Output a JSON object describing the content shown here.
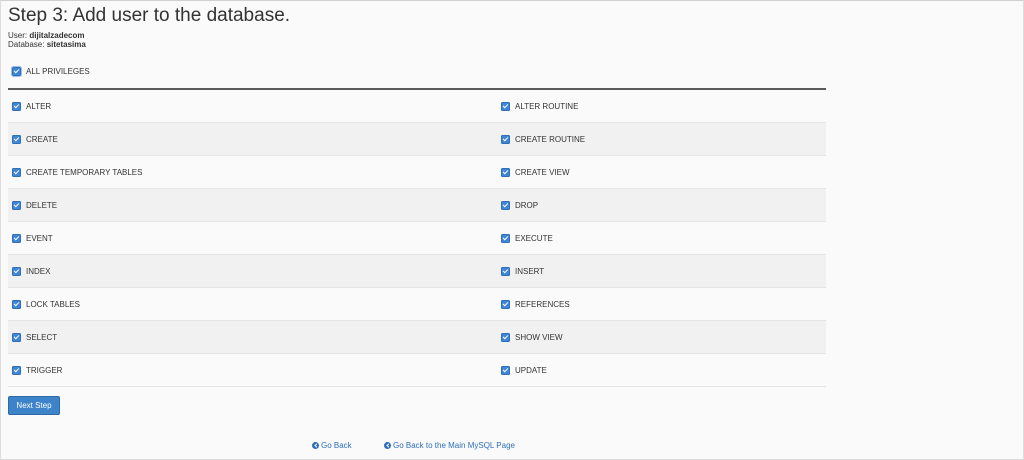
{
  "page": {
    "title": "Step 3: Add user to the database."
  },
  "meta": {
    "user_label": "User:",
    "user_value": "dijitalzadecom",
    "database_label": "Database:",
    "database_value": "sitetasima"
  },
  "all_privileges": {
    "label": "ALL PRIVILEGES",
    "checked": true
  },
  "privileges": {
    "rows": [
      {
        "left": "ALTER",
        "right": "ALTER ROUTINE"
      },
      {
        "left": "CREATE",
        "right": "CREATE ROUTINE"
      },
      {
        "left": "CREATE TEMPORARY TABLES",
        "right": "CREATE VIEW"
      },
      {
        "left": "DELETE",
        "right": "DROP"
      },
      {
        "left": "EVENT",
        "right": "EXECUTE"
      },
      {
        "left": "INDEX",
        "right": "INSERT"
      },
      {
        "left": "LOCK TABLES",
        "right": "REFERENCES"
      },
      {
        "left": "SELECT",
        "right": "SHOW VIEW"
      },
      {
        "left": "TRIGGER",
        "right": "UPDATE"
      }
    ]
  },
  "actions": {
    "next_step_label": "Next Step"
  },
  "footer_links": {
    "go_back": "Go Back",
    "go_back_main": "Go Back to the Main MySQL Page"
  },
  "colors": {
    "accent": "#3d83c9",
    "checkbox": "#3f86d8",
    "link": "#2f6fba",
    "row_alt": "#f1f1f1"
  }
}
